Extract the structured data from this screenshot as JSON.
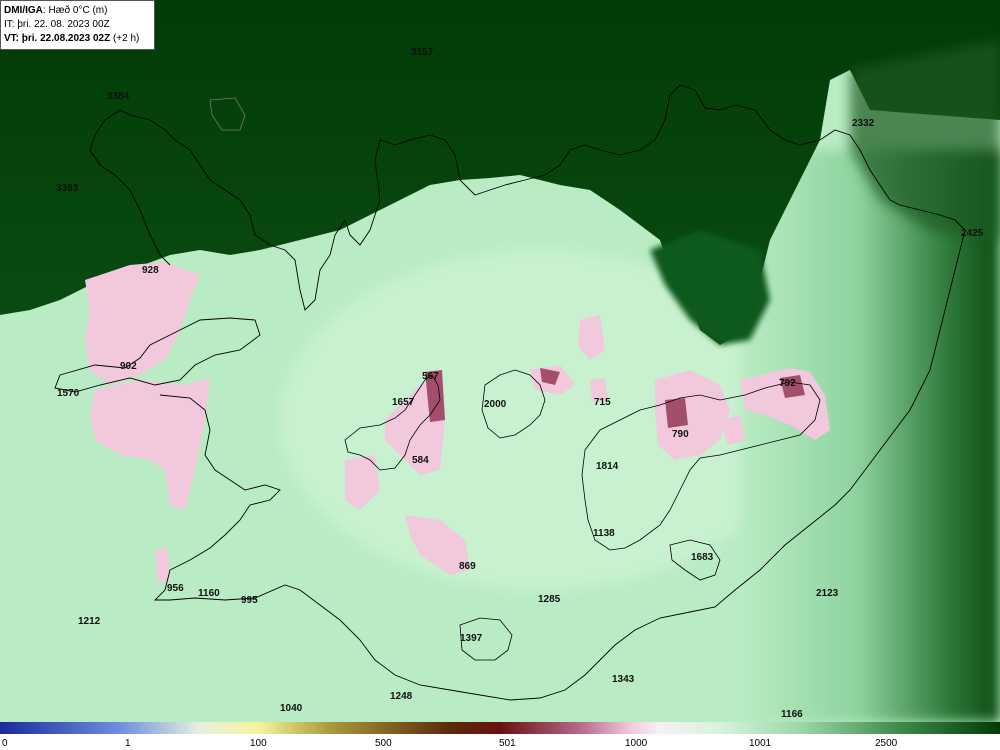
{
  "header": {
    "model": "DMI/IGA",
    "field": ": Hæð 0°C (m)",
    "init_time": "IT: þri. 22. 08. 2023 00Z",
    "valid_prefix": "VT: þri. 22.08.2023 02Z",
    "valid_offset": "(+2 h)"
  },
  "colors": {
    "dark_green": "#023b06",
    "mid_green": "#0b5a17",
    "light_green": "#b9ecc4",
    "pale_green": "#cdf3d4",
    "pink": "#f2c8dc",
    "maroon": "#a34f6c",
    "coastline": "#000000"
  },
  "point_labels": [
    {
      "id": "l3157",
      "text": "3157"
    },
    {
      "id": "l3384",
      "text": "3384"
    },
    {
      "id": "l2332",
      "text": "2332"
    },
    {
      "id": "l3393",
      "text": "3393"
    },
    {
      "id": "l2425",
      "text": "2425"
    },
    {
      "id": "l928",
      "text": "928"
    },
    {
      "id": "l902",
      "text": "902"
    },
    {
      "id": "l1570",
      "text": "1570"
    },
    {
      "id": "l567",
      "text": "567"
    },
    {
      "id": "l1657",
      "text": "1657"
    },
    {
      "id": "l2000",
      "text": "2000"
    },
    {
      "id": "l715",
      "text": "715"
    },
    {
      "id": "l792",
      "text": "792"
    },
    {
      "id": "l790",
      "text": "790"
    },
    {
      "id": "l584",
      "text": "584"
    },
    {
      "id": "l1814",
      "text": "1814"
    },
    {
      "id": "l1138",
      "text": "1138"
    },
    {
      "id": "l1683",
      "text": "1683"
    },
    {
      "id": "l869",
      "text": "869"
    },
    {
      "id": "l956",
      "text": "956"
    },
    {
      "id": "l1160",
      "text": "1160"
    },
    {
      "id": "l995",
      "text": "995"
    },
    {
      "id": "l1285",
      "text": "1285"
    },
    {
      "id": "l2123",
      "text": "2123"
    },
    {
      "id": "l1212",
      "text": "1212"
    },
    {
      "id": "l1397",
      "text": "1397"
    },
    {
      "id": "l1343",
      "text": "1343"
    },
    {
      "id": "l1248",
      "text": "1248"
    },
    {
      "id": "l1040",
      "text": "1040"
    },
    {
      "id": "l1166",
      "text": "1166"
    }
  ],
  "colorbar": {
    "ticks": [
      "0",
      "1",
      "100",
      "500",
      "501",
      "1000",
      "1001",
      "2500"
    ]
  }
}
